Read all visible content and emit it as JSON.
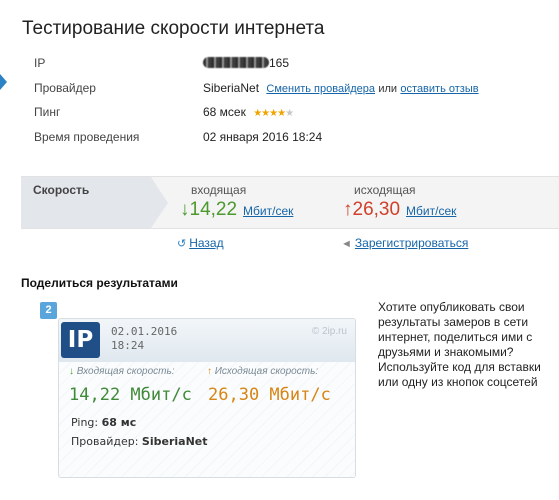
{
  "page": {
    "title": "Тестирование скорости интернета"
  },
  "info": {
    "ip": {
      "label": "IP",
      "value_suffix": "165"
    },
    "provider": {
      "label": "Провайдер",
      "value": "SiberiaNet",
      "change_link": "Сменить провайдера",
      "or_text": "или",
      "review_link": "оставить отзыв"
    },
    "ping": {
      "label": "Пинг",
      "value": "68 мсек",
      "rating": 4,
      "rating_max": 5
    },
    "time": {
      "label": "Время проведения",
      "value": "02 января 2016 18:24"
    }
  },
  "speed": {
    "label": "Скорость",
    "incoming": {
      "label": "входящая",
      "arrow": "↓",
      "value": "14,22",
      "unit": "Мбит/сек"
    },
    "outgoing": {
      "label": "исходящая",
      "arrow": "↑",
      "value": "26,30",
      "unit": "Мбит/сек"
    }
  },
  "nav": {
    "back": {
      "icon": "back-icon",
      "glyph": "↺",
      "label": "Назад"
    },
    "register": {
      "icon": "arrow-left-icon",
      "glyph": "◄",
      "label": "Зарегистрироваться"
    }
  },
  "share": {
    "title": "Поделиться результатами",
    "badge": "2",
    "description": "Хотите опубликовать свои результаты замеров в сети интернет, поделиться ими с друзьями и знакомыми? Используйте код для вставки или одну из кнопок соцсетей",
    "card": {
      "logo": "IP",
      "date": "02.01.2016",
      "time": "18:24",
      "brand": "© 2ip.ru",
      "incoming_label": "Входящая скорость:",
      "incoming_arrow": "↓",
      "incoming_value": "14,22 Мбит/с",
      "outgoing_label": "Исходящая скорость:",
      "outgoing_arrow": "↑",
      "outgoing_value": "26,30 Мбит/с",
      "ping_label": "Ping:",
      "ping_value": "68 мс",
      "provider_label": "Провайдер:",
      "provider_value": "SiberiaNet"
    }
  },
  "colors": {
    "accent": "#2b82c5",
    "link": "#1665a8",
    "download": "#4a9a2e",
    "upload": "#d0402a",
    "star": "#f0a400",
    "logo_bg": "#1f4f86"
  }
}
